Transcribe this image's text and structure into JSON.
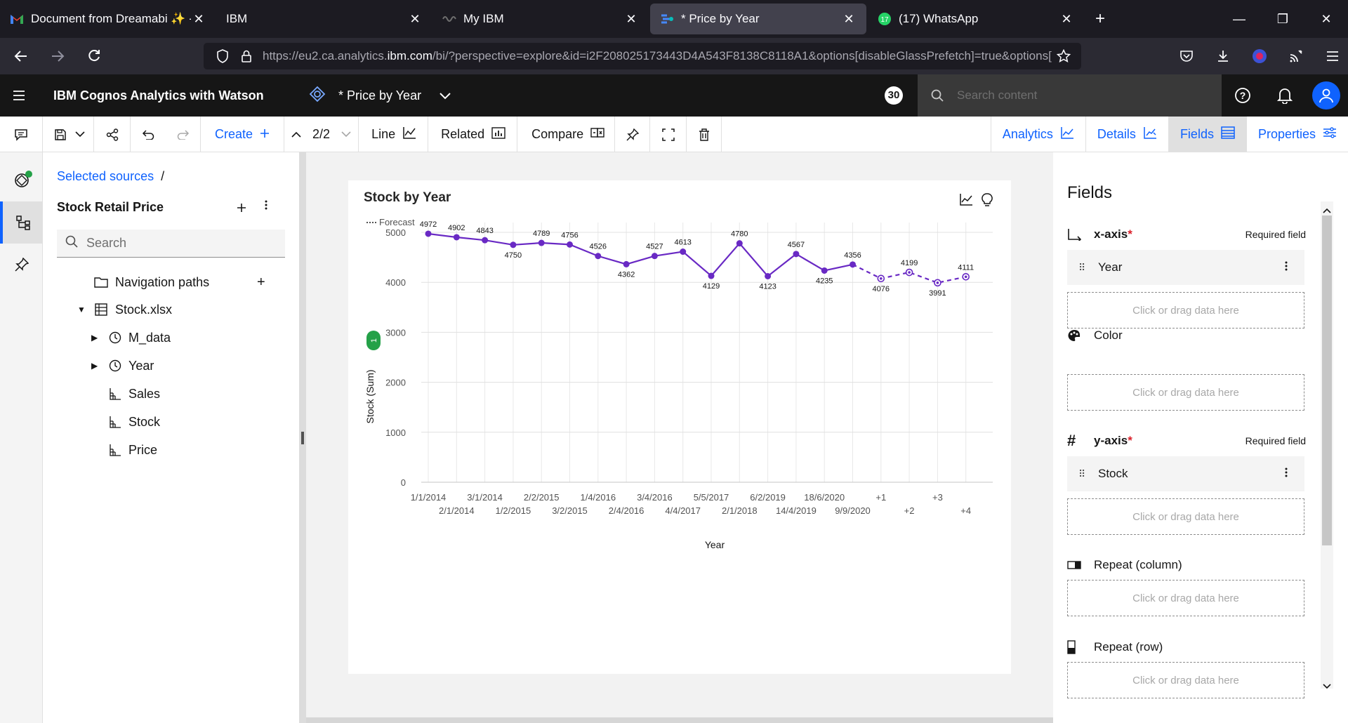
{
  "browser": {
    "tabs": [
      {
        "label": "Document from Dreamabi ✨ -",
        "icon": "gmail-icon",
        "active": false
      },
      {
        "label": "IBM",
        "icon": "",
        "active": false
      },
      {
        "label": "My IBM",
        "icon": "ibm-waves-icon",
        "active": false
      },
      {
        "label": "* Price by Year",
        "icon": "cognos-icon",
        "active": true
      },
      {
        "label": "(17) WhatsApp",
        "icon": "whatsapp-icon",
        "active": false
      }
    ],
    "whatsapp_badge": "17",
    "url_prefix": "https://eu2.ca.analytics.",
    "url_domain": "ibm.com",
    "url_suffix": "/bi/?perspective=explore&id=i2F208025173443D4A543F8138C8118A1&options[disableGlassPrefetch]=true&options["
  },
  "header": {
    "app_title": "IBM Cognos Analytics with Watson",
    "doc_title": "* Price by Year",
    "notification_count": "30",
    "search_placeholder": "Search content"
  },
  "toolbar": {
    "create_label": "Create",
    "page_indicator": "2/2",
    "line_label": "Line",
    "related_label": "Related",
    "compare_label": "Compare",
    "analytics_label": "Analytics",
    "details_label": "Details",
    "fields_label": "Fields",
    "properties_label": "Properties"
  },
  "sources": {
    "breadcrumb": "Selected sources",
    "breadcrumb_sep": "/",
    "name": "Stock Retail Price",
    "search_placeholder": "Search",
    "tree": [
      {
        "label": "Navigation paths",
        "icon": "folder-icon",
        "arrow": "",
        "add": "+"
      },
      {
        "label": "Stock.xlsx",
        "icon": "table-icon",
        "arrow": "▼"
      },
      {
        "label": "M_data",
        "icon": "clock-icon",
        "arrow": "▶"
      },
      {
        "label": "Year",
        "icon": "clock-icon",
        "arrow": "▶"
      },
      {
        "label": "Sales",
        "icon": "measure-icon",
        "arrow": ""
      },
      {
        "label": "Stock",
        "icon": "measure-icon",
        "arrow": ""
      },
      {
        "label": "Price",
        "icon": "measure-icon",
        "arrow": ""
      }
    ]
  },
  "chart_data": {
    "type": "line",
    "title": "Stock by Year",
    "legend": [
      "Forecast"
    ],
    "xlabel": "Year",
    "ylabel": "Stock (Sum)",
    "ylabel_badge": "1",
    "ylim": [
      0,
      5000
    ],
    "yticks": [
      0,
      1000,
      2000,
      3000,
      4000,
      5000
    ],
    "grid": true,
    "categories": [
      "1/1/2014",
      "2/1/2014",
      "3/1/2014",
      "1/2/2015",
      "2/2/2015",
      "3/2/2015",
      "1/4/2016",
      "2/4/2016",
      "3/4/2016",
      "4/4/2017",
      "5/5/2017",
      "2/1/2018",
      "6/2/2019",
      "14/4/2019",
      "18/6/2020",
      "9/9/2020",
      "+1",
      "+2",
      "+3",
      "+4"
    ],
    "series": [
      {
        "name": "",
        "values": [
          4972,
          4902,
          4843,
          4750,
          4789,
          4756,
          4526,
          4362,
          4527,
          4613,
          4129,
          4780,
          4123,
          4567,
          4235,
          4356,
          null,
          null,
          null,
          null
        ]
      },
      {
        "name": "Forecast",
        "values": [
          null,
          null,
          null,
          null,
          null,
          null,
          null,
          null,
          null,
          null,
          null,
          null,
          null,
          null,
          null,
          4356,
          4076,
          4199,
          3991,
          4111
        ]
      }
    ],
    "colors": {
      "actual": "#6929c4",
      "forecast": "#6929c4"
    }
  },
  "fields": {
    "title": "Fields",
    "xaxis_label": "x-axis",
    "required_text": "Required field",
    "xaxis_value": "Year",
    "drop_text": "Click or drag data here",
    "color_label": "Color",
    "yaxis_label": "y-axis",
    "yaxis_value": "Stock",
    "repeat_col_label": "Repeat (column)",
    "repeat_row_label": "Repeat (row)",
    "required_star": "*"
  }
}
